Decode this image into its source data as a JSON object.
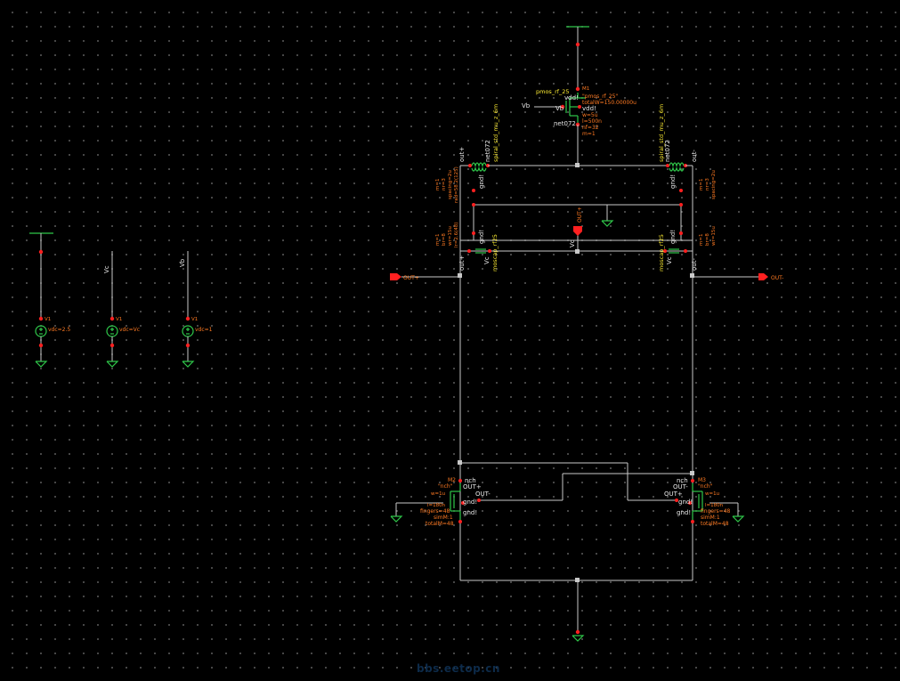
{
  "sources": {
    "v_supply": {
      "name": "V1",
      "value": "vdc=2.5"
    },
    "v_c": {
      "name": "V1",
      "net": "Vc",
      "value": "vdc=Vc"
    },
    "v_b": {
      "name": "V1",
      "net": "Vb",
      "value": "vdc=1"
    }
  },
  "pmos_tail": {
    "model": "pmos_rf_25",
    "name": "M1",
    "model_quoted": "\"pmos_rf_25\"",
    "total_w": "totalW=150.00000u",
    "gate_net": "Vb",
    "vdd": "vdd!",
    "w": "w=5u",
    "l": "l=500n",
    "nf": "nf=32",
    "m": "m=1",
    "drain_net": "net072"
  },
  "inductors": {
    "left": {
      "model": "spiral_std_mu_z_6m",
      "net": "net072",
      "out": "out+"
    },
    "right": {
      "model": "spiral_std_mu_z_6m",
      "net": "net072",
      "out": "out-"
    }
  },
  "varactors": {
    "left": {
      "model": "moscap_rf25",
      "net": "Vc",
      "out": "out+"
    },
    "right": {
      "model": "moscap_rf25",
      "net": "Vc",
      "out": "out-"
    }
  },
  "pins": {
    "out_plus": "OUT+",
    "out_minus": "OUT-",
    "vc_center": "Vc",
    "out_top": "OUT+"
  },
  "nmos": {
    "left": {
      "name": "M2",
      "model": "nch",
      "model_quoted": "\"nch\"",
      "drain": "OUT+",
      "gate": "OUT-",
      "body": "gnd!",
      "fingers": "fingers=48",
      "simm": "simM:1",
      "totalm": "totalM=48"
    },
    "right": {
      "name": "M3",
      "model": "nch",
      "model_quoted": "\"nch\"",
      "drain": "OUT-",
      "gate": "OUT+",
      "body": "gnd!",
      "fingers": "fingers=48",
      "simm": "simM:1",
      "totalm": "totalM=48"
    }
  },
  "labels": {
    "gnd": "gnd!",
    "vdd": "vdd!"
  },
  "watermark": "bbs.eetop.cn",
  "colors": {
    "wire": "#c8c8c8",
    "symbol": "#2fc84a",
    "pin": "#ff2020",
    "label": "#ff7a22",
    "instance": "#ffee33"
  }
}
